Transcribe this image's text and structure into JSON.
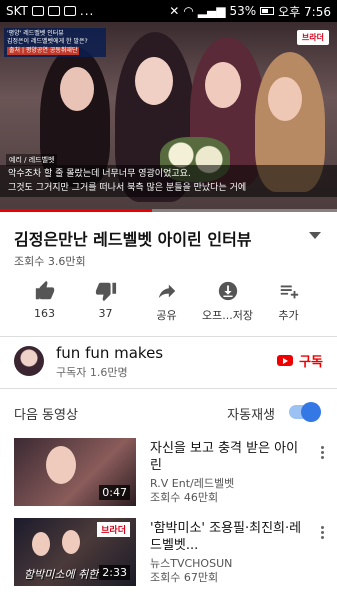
{
  "status_bar": {
    "carrier": "SKT",
    "battery": "53%",
    "time": "오후 7:56"
  },
  "video": {
    "news_box_line1": "'평양' 레드벨벳 인터뷰",
    "news_box_line2": "김정은이 레드벨벳에게 한 말은?",
    "news_box_source": "출처 | 평양공연 공동취재단",
    "brand": "브라더",
    "speaker_tag": "예리 / 레드벨벳",
    "caption_line1": "악수조차 할 줄 몰랐는데 너무너무 영광이었고요.",
    "caption_line2": "그것도 그거지만 그거를 떠나서 북측 많은 분들을 만났다는 거에",
    "progress": 0.45
  },
  "title": "김정은만난 레드벨벳 아이린 인터뷰",
  "views": "조회수 3.6만회",
  "actions": [
    {
      "name": "like",
      "label": "163"
    },
    {
      "name": "dislike",
      "label": "37"
    },
    {
      "name": "share",
      "label": "공유"
    },
    {
      "name": "offline",
      "label": "오프...저장"
    },
    {
      "name": "add",
      "label": "추가"
    }
  ],
  "channel": {
    "name": "fun fun makes",
    "subscribers": "구독자 1.6만명",
    "subscribe_label": "구독"
  },
  "upnext_label": "다음 동영상",
  "autoplay_label": "자동재생",
  "autoplay_on": true,
  "list": [
    {
      "title": "자신을 보고 충격 받은 아이린",
      "channel": "R.V Ent/레드벨벳",
      "views": "조회수 46만회",
      "duration": "0:47"
    },
    {
      "title": "'함박미소' 조용필·최진희·레드벨벳...",
      "channel": "뉴스TVCHOSUN",
      "views": "조회수 67만회",
      "duration": "2:33",
      "brand": "브라더",
      "overlay_text": "함박미소에 취한"
    }
  ]
}
